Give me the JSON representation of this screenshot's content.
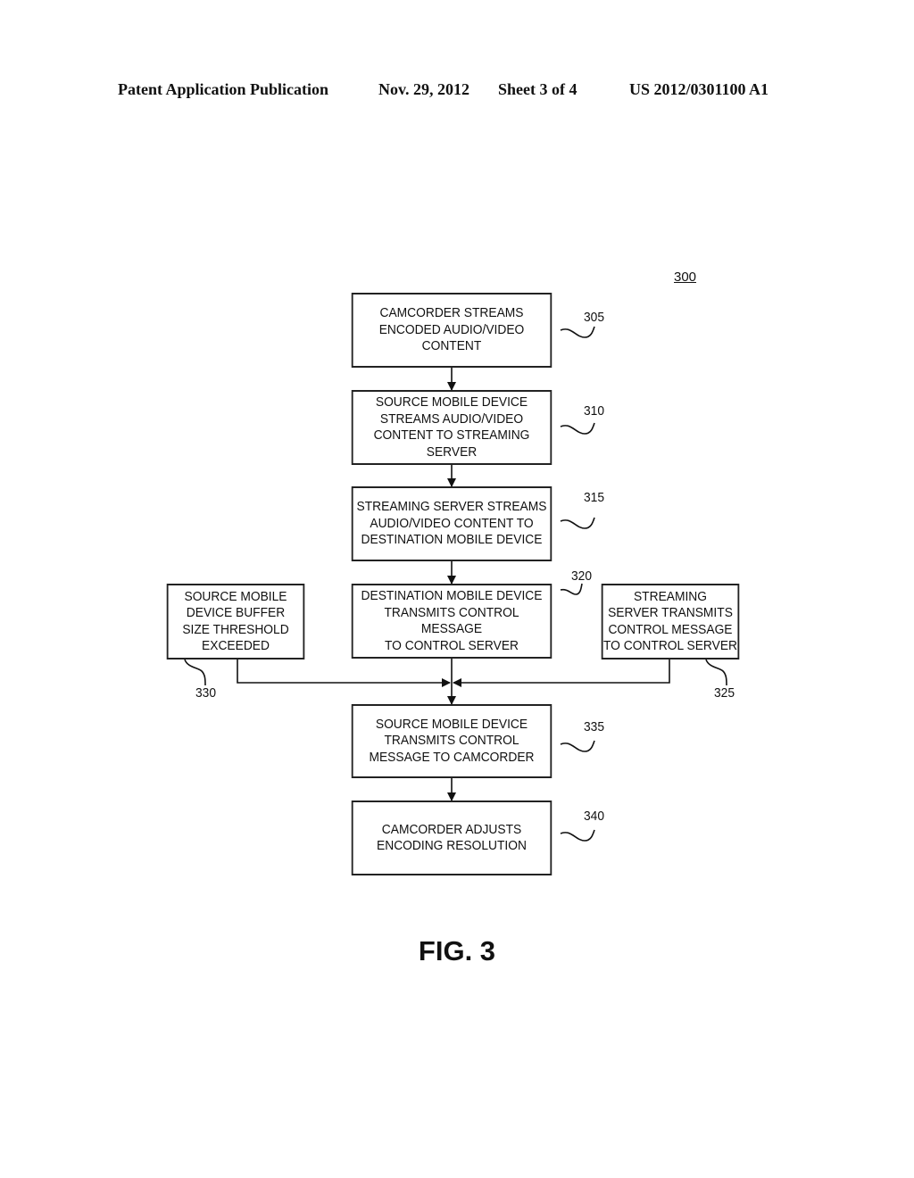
{
  "header": {
    "publication": "Patent Application Publication",
    "date": "Nov. 29, 2012",
    "sheet": "Sheet 3 of 4",
    "number": "US 2012/0301100 A1"
  },
  "diagram": {
    "ref": "300",
    "figure_label": "FIG. 3",
    "steps": [
      {
        "id": "305",
        "text": "CAMCORDER STREAMS\nENCODED AUDIO/VIDEO\nCONTENT"
      },
      {
        "id": "310",
        "text": "SOURCE MOBILE DEVICE\nSTREAMS AUDIO/VIDEO\nCONTENT TO STREAMING\nSERVER"
      },
      {
        "id": "315",
        "text": "STREAMING SERVER STREAMS\nAUDIO/VIDEO CONTENT TO\nDESTINATION MOBILE DEVICE"
      },
      {
        "id": "320",
        "text": "DESTINATION MOBILE DEVICE\nTRANSMITS CONTROL MESSAGE\nTO CONTROL SERVER"
      },
      {
        "id": "330",
        "text": "SOURCE MOBILE\nDEVICE BUFFER\nSIZE THRESHOLD\nEXCEEDED"
      },
      {
        "id": "325",
        "text": "STREAMING\nSERVER TRANSMITS\nCONTROL MESSAGE\nTO CONTROL SERVER"
      },
      {
        "id": "335",
        "text": "SOURCE MOBILE DEVICE\nTRANSMITS CONTROL\nMESSAGE TO  CAMCORDER"
      },
      {
        "id": "340",
        "text": "CAMCORDER ADJUSTS\nENCODING RESOLUTION"
      }
    ]
  }
}
